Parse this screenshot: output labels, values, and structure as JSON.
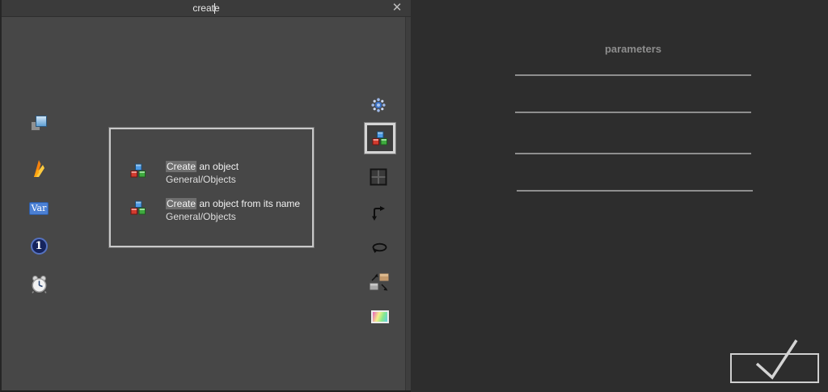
{
  "search": {
    "value": "create",
    "close_glyph": "✕"
  },
  "left_rail": {
    "var_label": "Var",
    "one_label": "1"
  },
  "results": {
    "items": [
      {
        "match": "Create",
        "rest": " an object",
        "subtitle": "General/Objects"
      },
      {
        "match": "Create",
        "rest": " an object from its name",
        "subtitle": "General/Objects"
      }
    ]
  },
  "right_panel": {
    "title": "parameters",
    "parameter_line_count": "4"
  },
  "colors": {
    "left_panel_bg": "#474747",
    "search_bar_bg": "#3b3b3b",
    "right_panel_bg": "#2d2d2d",
    "selection_border": "#c9c9c9",
    "highlight_bg": "#6f6f6f",
    "param_line": "#8e8e8e",
    "accent_blue": "#4b80d4"
  }
}
